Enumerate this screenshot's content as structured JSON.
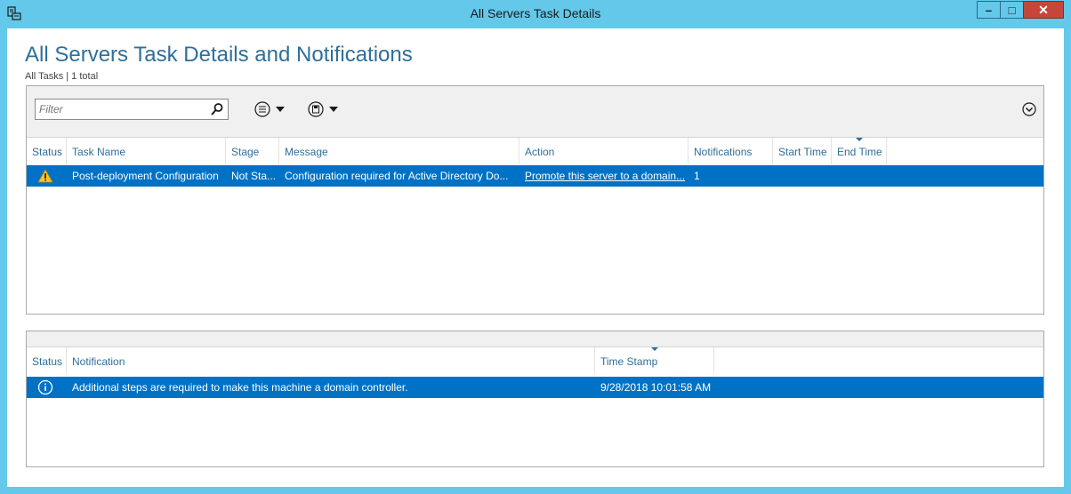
{
  "window": {
    "title": "All Servers Task Details",
    "controls": {
      "minimize": "–",
      "maximize": "□",
      "close": "✕"
    }
  },
  "page": {
    "title": "All Servers Task Details and Notifications",
    "subtitle": "All Tasks | 1 total"
  },
  "toolbar": {
    "filter_placeholder": "Filter"
  },
  "tasks": {
    "columns": [
      "Status",
      "Task Name",
      "Stage",
      "Message",
      "Action",
      "Notifications",
      "Start Time",
      "End Time"
    ],
    "rows": [
      {
        "status_icon": "warning-icon",
        "task_name": "Post-deployment Configuration",
        "stage": "Not Sta...",
        "message": "Configuration required for Active Directory Do...",
        "action": "Promote this server to a domain...",
        "notifications": "1",
        "start_time": "",
        "end_time": ""
      }
    ]
  },
  "notifications": {
    "columns": [
      "Status",
      "Notification",
      "Time Stamp"
    ],
    "rows": [
      {
        "status_icon": "info-icon",
        "notification": "Additional steps are required to make this machine a domain controller.",
        "time_stamp": "9/28/2018 10:01:58 AM"
      }
    ]
  },
  "colors": {
    "frame": "#63c8ea",
    "accent": "#2d6f9c",
    "selection": "#0072c6",
    "close": "#c7463b"
  }
}
